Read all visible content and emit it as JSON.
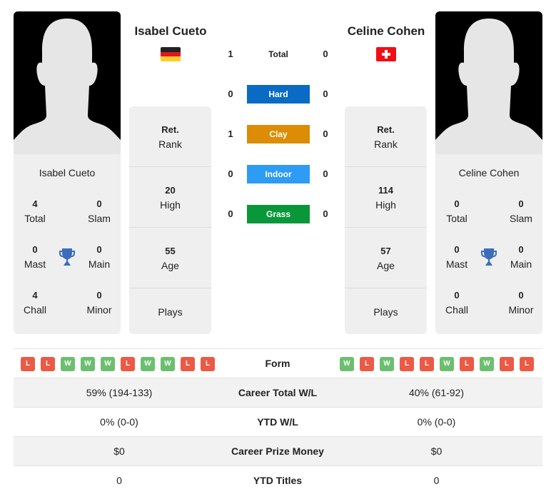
{
  "colors": {
    "hard": "#0a6bc4",
    "clay": "#dc8c05",
    "indoor": "#2e9bf5",
    "grass": "#0a973a",
    "win": "#6cbf6f",
    "loss": "#eb5a45",
    "trophy": "#3b6dbd"
  },
  "player1": {
    "name": "Isabel Cueto",
    "flag": "germany-flag",
    "photo": "player-silhouette",
    "titles": {
      "total": {
        "value": "4",
        "label": "Total"
      },
      "slam": {
        "value": "0",
        "label": "Slam"
      },
      "mast": {
        "value": "0",
        "label": "Mast"
      },
      "main": {
        "value": "0",
        "label": "Main"
      },
      "chall": {
        "value": "4",
        "label": "Chall"
      },
      "minor": {
        "value": "0",
        "label": "Minor"
      }
    },
    "rank": {
      "value": "Ret.",
      "label": "Rank"
    },
    "high": {
      "value": "20",
      "label": "High"
    },
    "age": {
      "value": "55",
      "label": "Age"
    },
    "plays": {
      "value": "",
      "label": "Plays"
    },
    "form": [
      "L",
      "L",
      "W",
      "W",
      "W",
      "L",
      "W",
      "W",
      "L",
      "L"
    ]
  },
  "player2": {
    "name": "Celine Cohen",
    "flag": "switzerland-flag",
    "photo": "player-silhouette",
    "titles": {
      "total": {
        "value": "0",
        "label": "Total"
      },
      "slam": {
        "value": "0",
        "label": "Slam"
      },
      "mast": {
        "value": "0",
        "label": "Mast"
      },
      "main": {
        "value": "0",
        "label": "Main"
      },
      "chall": {
        "value": "0",
        "label": "Chall"
      },
      "minor": {
        "value": "0",
        "label": "Minor"
      }
    },
    "rank": {
      "value": "Ret.",
      "label": "Rank"
    },
    "high": {
      "value": "114",
      "label": "High"
    },
    "age": {
      "value": "57",
      "label": "Age"
    },
    "plays": {
      "value": "",
      "label": "Plays"
    },
    "form": [
      "W",
      "L",
      "W",
      "L",
      "L",
      "W",
      "L",
      "W",
      "L",
      "L"
    ]
  },
  "h2h": [
    {
      "surface": "Total",
      "p1": "1",
      "p2": "0"
    },
    {
      "surface": "Hard",
      "p1": "0",
      "p2": "0"
    },
    {
      "surface": "Clay",
      "p1": "1",
      "p2": "0"
    },
    {
      "surface": "Indoor",
      "p1": "0",
      "p2": "0"
    },
    {
      "surface": "Grass",
      "p1": "0",
      "p2": "0"
    }
  ],
  "table": {
    "form_label": "Form",
    "rows": [
      {
        "label": "Career Total W/L",
        "p1": "59% (194-133)",
        "p2": "40% (61-92)"
      },
      {
        "label": "YTD W/L",
        "p1": "0% (0-0)",
        "p2": "0% (0-0)"
      },
      {
        "label": "Career Prize Money",
        "p1": "$0",
        "p2": "$0"
      },
      {
        "label": "YTD Titles",
        "p1": "0",
        "p2": "0"
      }
    ]
  }
}
